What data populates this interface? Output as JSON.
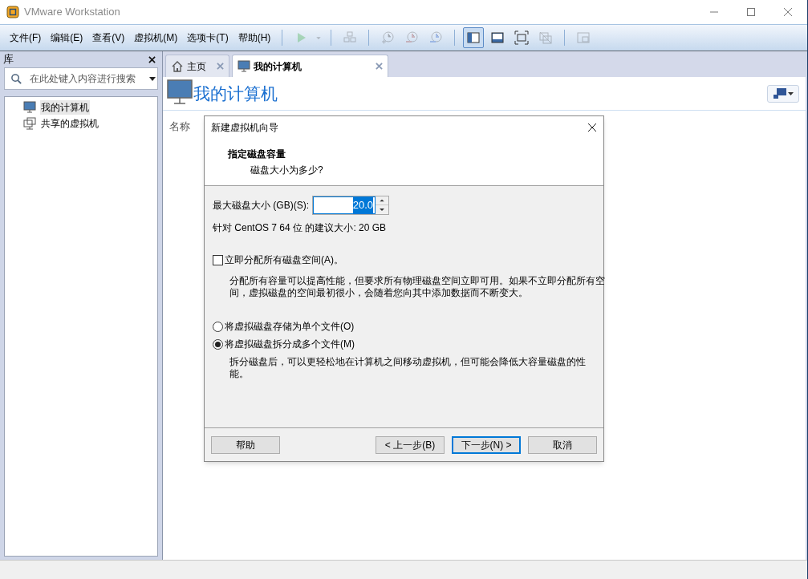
{
  "window": {
    "title": "VMware Workstation"
  },
  "menu": [
    "文件(F)",
    "编辑(E)",
    "查看(V)",
    "虚拟机(M)",
    "选项卡(T)",
    "帮助(H)"
  ],
  "toolbar": [
    {
      "buttons": [
        {
          "kind": "play",
          "disabled": true,
          "selected": false
        },
        {
          "kind": "caret",
          "disabled": true,
          "selected": false
        }
      ]
    },
    {
      "buttons": [
        {
          "kind": "network",
          "disabled": true,
          "selected": false
        }
      ]
    },
    {
      "buttons": [
        {
          "kind": "snapshot",
          "disabled": true,
          "selected": false
        },
        {
          "kind": "revert",
          "disabled": true,
          "selected": false
        },
        {
          "kind": "manage",
          "disabled": true,
          "selected": false
        }
      ]
    },
    {
      "buttons": [
        {
          "kind": "library",
          "disabled": false,
          "selected": true
        },
        {
          "kind": "console",
          "disabled": false,
          "selected": false
        },
        {
          "kind": "fullscreen",
          "disabled": false,
          "selected": false
        },
        {
          "kind": "unity",
          "disabled": true,
          "selected": false
        }
      ]
    },
    {
      "buttons": [
        {
          "kind": "thumbnail",
          "disabled": true,
          "selected": false
        }
      ]
    }
  ],
  "library": {
    "title": "库",
    "search": {
      "placeholder": "在此处键入内容进行搜索"
    },
    "items": [
      {
        "label": "我的计算机",
        "kind": "computer",
        "selected": true
      },
      {
        "label": "共享的虚拟机",
        "kind": "shared",
        "selected": false
      }
    ]
  },
  "tabs": [
    {
      "label": "主页",
      "kind": "home",
      "selected": false
    },
    {
      "label": "我的计算机",
      "kind": "computer",
      "selected": true
    }
  ],
  "page": {
    "title": "我的计算机",
    "column_header": "名称"
  },
  "dialog": {
    "title": "新建虚拟机向导",
    "heading": "指定磁盘容量",
    "subheading": "磁盘大小为多少?",
    "size_label": "最大磁盘大小 (GB)(S):",
    "size_value": "20.0",
    "recommendation": "针对 CentOS 7 64 位 的建议大小: 20 GB",
    "allocate": {
      "label": "立即分配所有磁盘空间(A)。",
      "checked": false,
      "description": "分配所有容量可以提高性能，但要求所有物理磁盘空间立即可用。如果不立即分配所有空间，虚拟磁盘的空间最初很小，会随着您向其中添加数据而不断变大。"
    },
    "storage_options": [
      {
        "label": "将虚拟磁盘存储为单个文件(O)",
        "selected": false
      },
      {
        "label": "将虚拟磁盘拆分成多个文件(M)",
        "selected": true,
        "description": "拆分磁盘后，可以更轻松地在计算机之间移动虚拟机，但可能会降低大容量磁盘的性能。"
      }
    ],
    "buttons": [
      {
        "label": "帮助",
        "selected": false
      },
      {
        "label": "< 上一步(B)",
        "selected": false
      },
      {
        "label": "下一步(N) >",
        "selected": true
      },
      {
        "label": "取消",
        "selected": false
      }
    ]
  }
}
